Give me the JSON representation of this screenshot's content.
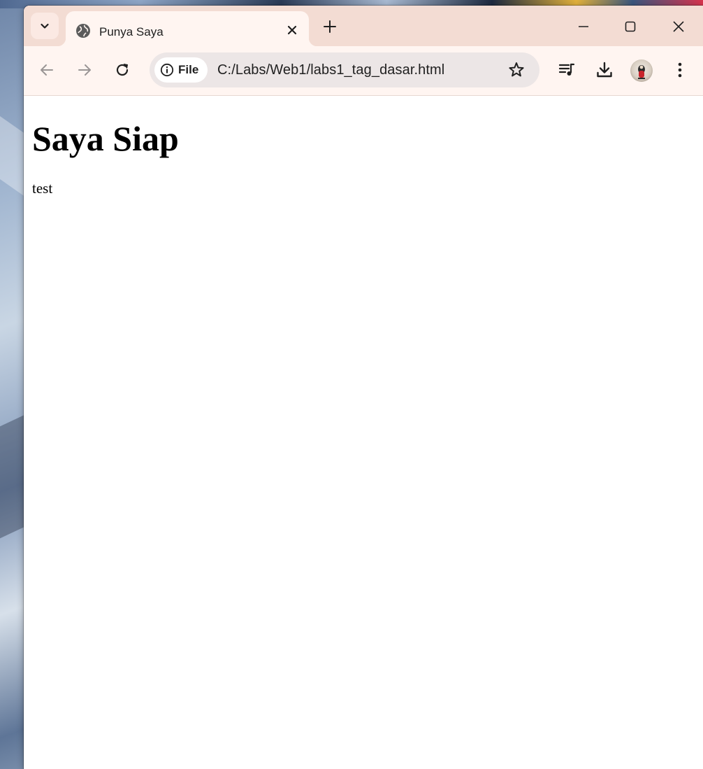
{
  "browser": {
    "tab": {
      "title": "Punya Saya",
      "favicon": "globe-icon"
    },
    "omnibox": {
      "chip_label": "File",
      "url": "C:/Labs/Web1/labs1_tag_dasar.html"
    }
  },
  "page": {
    "heading": "Saya Siap",
    "paragraph": "test"
  }
}
